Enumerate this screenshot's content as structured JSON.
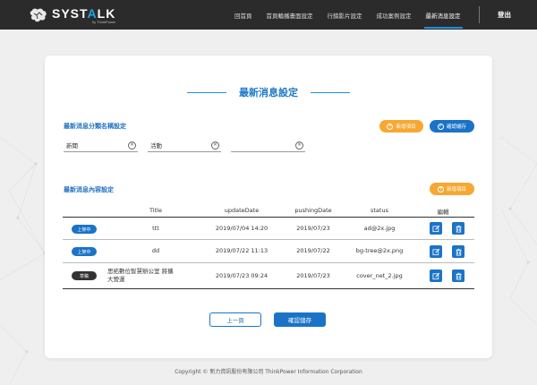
{
  "brand": {
    "name_main": "SYST",
    "name_accent": "A",
    "name_tail": "LK",
    "tagline": "by ThinkPower"
  },
  "nav": {
    "items": [
      {
        "label": "回首頁",
        "active": false
      },
      {
        "label": "首頁輪播畫面設定",
        "active": false
      },
      {
        "label": "行銷影片設定",
        "active": false
      },
      {
        "label": "成功案例設定",
        "active": false
      },
      {
        "label": "最新消息設定",
        "active": true
      }
    ],
    "logout": "登出"
  },
  "page": {
    "title": "最新消息設定"
  },
  "category_section": {
    "title": "最新消息分類名稱設定",
    "add_label": "新增項目",
    "save_label": "確認儲存",
    "fields": [
      {
        "value": "新聞"
      },
      {
        "value": "活動"
      },
      {
        "value": ""
      }
    ]
  },
  "content_section": {
    "title": "最新消息內容設定",
    "add_label": "新增項目"
  },
  "table": {
    "headers": [
      "Title",
      "updateDate",
      "pushingDate",
      "status",
      "編輯"
    ],
    "rows": [
      {
        "badge": "上架中",
        "badge_type": "on",
        "title_lines": [
          "ttt"
        ],
        "updateDate": "2019/07/04 14:20",
        "pushingDate": "2019/07/23",
        "status": "ad@2x.jpg"
      },
      {
        "badge": "上架中",
        "badge_type": "on",
        "title_lines": [
          "dd"
        ],
        "updateDate": "2019/07/22 11:13",
        "pushingDate": "2019/07/22",
        "status": "bg-tree@2x.png"
      },
      {
        "badge": "草稿",
        "badge_type": "draft",
        "title_lines": [
          "思拓數位智慧辦公室 將攜",
          "大營運"
        ],
        "updateDate": "2019/07/23 09:24",
        "pushingDate": "2019/07/23",
        "status": "cover_net_2.jpg"
      }
    ]
  },
  "actions": {
    "prev": "上一頁",
    "confirm": "確認儲存"
  },
  "footer": {
    "text": "Copyright © 新力資訊股份有限公司 ThinkPower Information Corporation"
  },
  "colors": {
    "accent": "#1b73c7",
    "orange": "#f7a833",
    "topbar": "#2b2b2b"
  },
  "icons": {
    "edit": "edit-icon",
    "delete": "trash-icon",
    "add": "plus-circle-icon",
    "save": "check-circle-icon",
    "clear": "clear-circle-icon"
  }
}
